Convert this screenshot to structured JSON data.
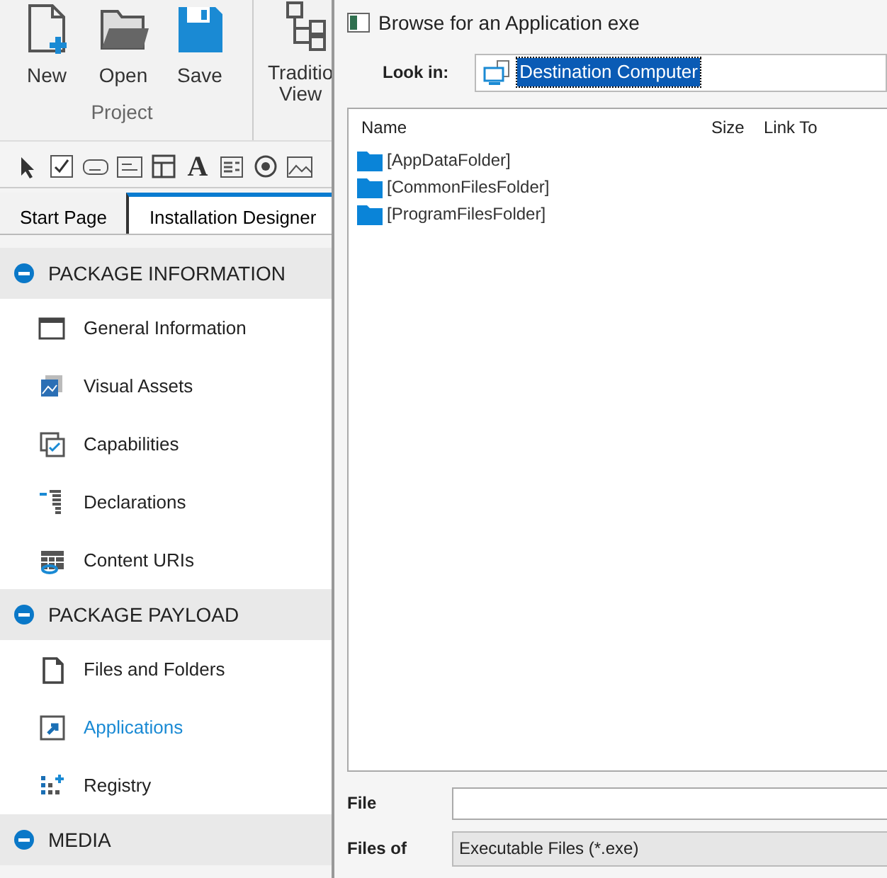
{
  "ribbon": {
    "buttons": [
      {
        "kind": "new",
        "label": "New"
      },
      {
        "kind": "open",
        "label": "Open"
      },
      {
        "kind": "save",
        "label": "Save"
      },
      {
        "kind": "tree",
        "label": "Traditio\nView"
      }
    ],
    "group_label": "Project"
  },
  "toolbar": [
    {
      "kind": "pointer"
    },
    {
      "kind": "checkbox"
    },
    {
      "kind": "ab"
    },
    {
      "kind": "abl"
    },
    {
      "kind": "form"
    },
    {
      "kind": "glyph",
      "text": "A"
    },
    {
      "kind": "list"
    },
    {
      "kind": "radio"
    },
    {
      "kind": "image"
    }
  ],
  "tabs": [
    {
      "label": "Start Page",
      "selected": false
    },
    {
      "label": "Installation Designer",
      "selected": true
    }
  ],
  "sidebar": [
    {
      "title": "PACKAGE INFORMATION",
      "expanded": true,
      "items": [
        {
          "kind": "window",
          "label": "General Information",
          "selected": false
        },
        {
          "kind": "assets",
          "label": "Visual Assets",
          "selected": false
        },
        {
          "kind": "capabilities",
          "label": "Capabilities",
          "selected": false
        },
        {
          "kind": "declarations",
          "label": "Declarations",
          "selected": false
        },
        {
          "kind": "uris",
          "label": "Content URIs",
          "selected": false
        }
      ]
    },
    {
      "title": "PACKAGE PAYLOAD",
      "expanded": true,
      "items": [
        {
          "kind": "files",
          "label": "Files and Folders",
          "selected": false
        },
        {
          "kind": "apps",
          "label": "Applications",
          "selected": true
        },
        {
          "kind": "registry",
          "label": "Registry",
          "selected": false
        }
      ]
    },
    {
      "title": "MEDIA",
      "expanded": true
    }
  ],
  "dialog": {
    "title": "Browse for an Application exe",
    "look_in_label": "Look in:",
    "look_in_value": "Destination Computer",
    "columns": [
      "Name",
      "Size",
      "Link To"
    ],
    "rows": [
      {
        "name": "[AppDataFolder]"
      },
      {
        "name": "[CommonFilesFolder]"
      },
      {
        "name": "[ProgramFilesFolder]"
      }
    ],
    "file_label": "File",
    "files_of_label": "Files of",
    "files_of_value": "Executable Files (*.exe)"
  }
}
